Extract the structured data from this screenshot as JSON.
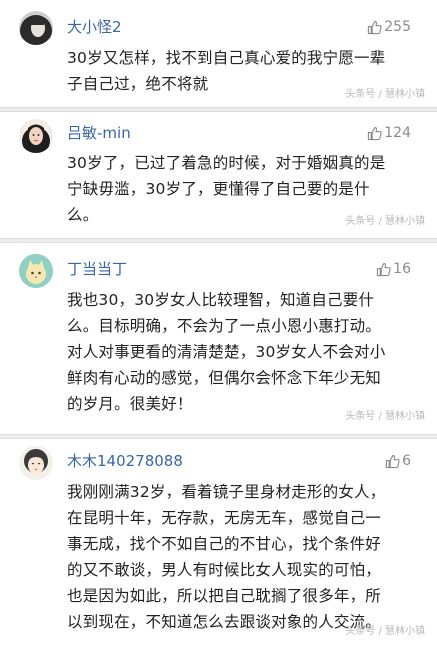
{
  "comments": [
    {
      "username": "大小怪2",
      "likes": "255",
      "lines": [
        "30岁又怎样，找不到自己真心爱的我宁愿一辈",
        "子自己过，绝不将就"
      ],
      "watermark": "头条号 / 慧林小镇",
      "avatar_icon": "dark-haired-woman-avatar-icon"
    },
    {
      "username": "吕敏-min",
      "likes": "124",
      "lines": [
        "30岁了，已过了着急的时候，对于婚姻真的是",
        "宁缺毋滥，30岁了，更懂得了自己要的是什",
        "么。"
      ],
      "watermark": "头条号 / 慧林小镇",
      "avatar_icon": "woman-portrait-avatar-icon"
    },
    {
      "username": "丁当当丁",
      "likes": "16",
      "lines": [
        "我也30，30岁女人比较理智，知道自己要什",
        "么。目标明确，不会为了一点小恩小惠打动。",
        "对人对事更看的清清楚楚，30岁女人不会对小",
        "鲜肉有心动的感觉，但偶尔会怀念下年少无知",
        "的岁月。很美好！"
      ],
      "watermark": "头条号 / 慧林小镇",
      "avatar_icon": "cartoon-cat-avatar-icon"
    },
    {
      "username": "木木140278088",
      "likes": "6",
      "lines": [
        "我刚刚满32岁，看着镜子里身材走形的女人，",
        "在昆明十年，无存款，无房无车，感觉自己一",
        "事无成，找个不如自己的不甘心，找个条件好",
        "的又不敢谈，男人有时候比女人现实的可怕，",
        "也是因为如此，所以把自己耽搁了很多年，所",
        "以到现在，不知道怎么去跟谈对象的人交流。"
      ],
      "watermark": "头条号 / 慧林小镇",
      "avatar_icon": "cartoon-girl-avatar-icon"
    }
  ]
}
